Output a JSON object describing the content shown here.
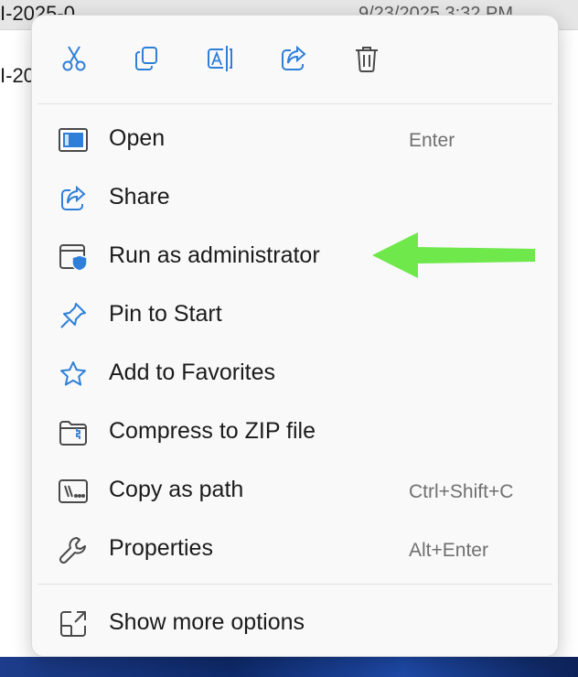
{
  "background": {
    "row1_name": "I-2025-0",
    "row1_date": "9/23/2025 3:32 PM",
    "row2_name": "I-20"
  },
  "toolbar": {
    "buttons": [
      {
        "icon": "cut-icon"
      },
      {
        "icon": "copy-icon"
      },
      {
        "icon": "rename-icon"
      },
      {
        "icon": "share-icon"
      },
      {
        "icon": "delete-icon"
      }
    ]
  },
  "menu": {
    "items": [
      {
        "label": "Open",
        "shortcut": "Enter",
        "icon": "open-icon"
      },
      {
        "label": "Share",
        "shortcut": "",
        "icon": "share-icon"
      },
      {
        "label": "Run as administrator",
        "shortcut": "",
        "icon": "shield-icon"
      },
      {
        "label": "Pin to Start",
        "shortcut": "",
        "icon": "pin-icon"
      },
      {
        "label": "Add to Favorites",
        "shortcut": "",
        "icon": "star-icon"
      },
      {
        "label": "Compress to ZIP file",
        "shortcut": "",
        "icon": "zip-icon"
      },
      {
        "label": "Copy as path",
        "shortcut": "Ctrl+Shift+C",
        "icon": "path-icon"
      },
      {
        "label": "Properties",
        "shortcut": "Alt+Enter",
        "icon": "wrench-icon"
      }
    ],
    "more": {
      "label": "Show more options",
      "icon": "more-options-icon"
    }
  },
  "colors": {
    "accent": "#2f7fd8",
    "icon_gray": "#4a4a4a",
    "annotation_arrow": "#6ee84a"
  }
}
